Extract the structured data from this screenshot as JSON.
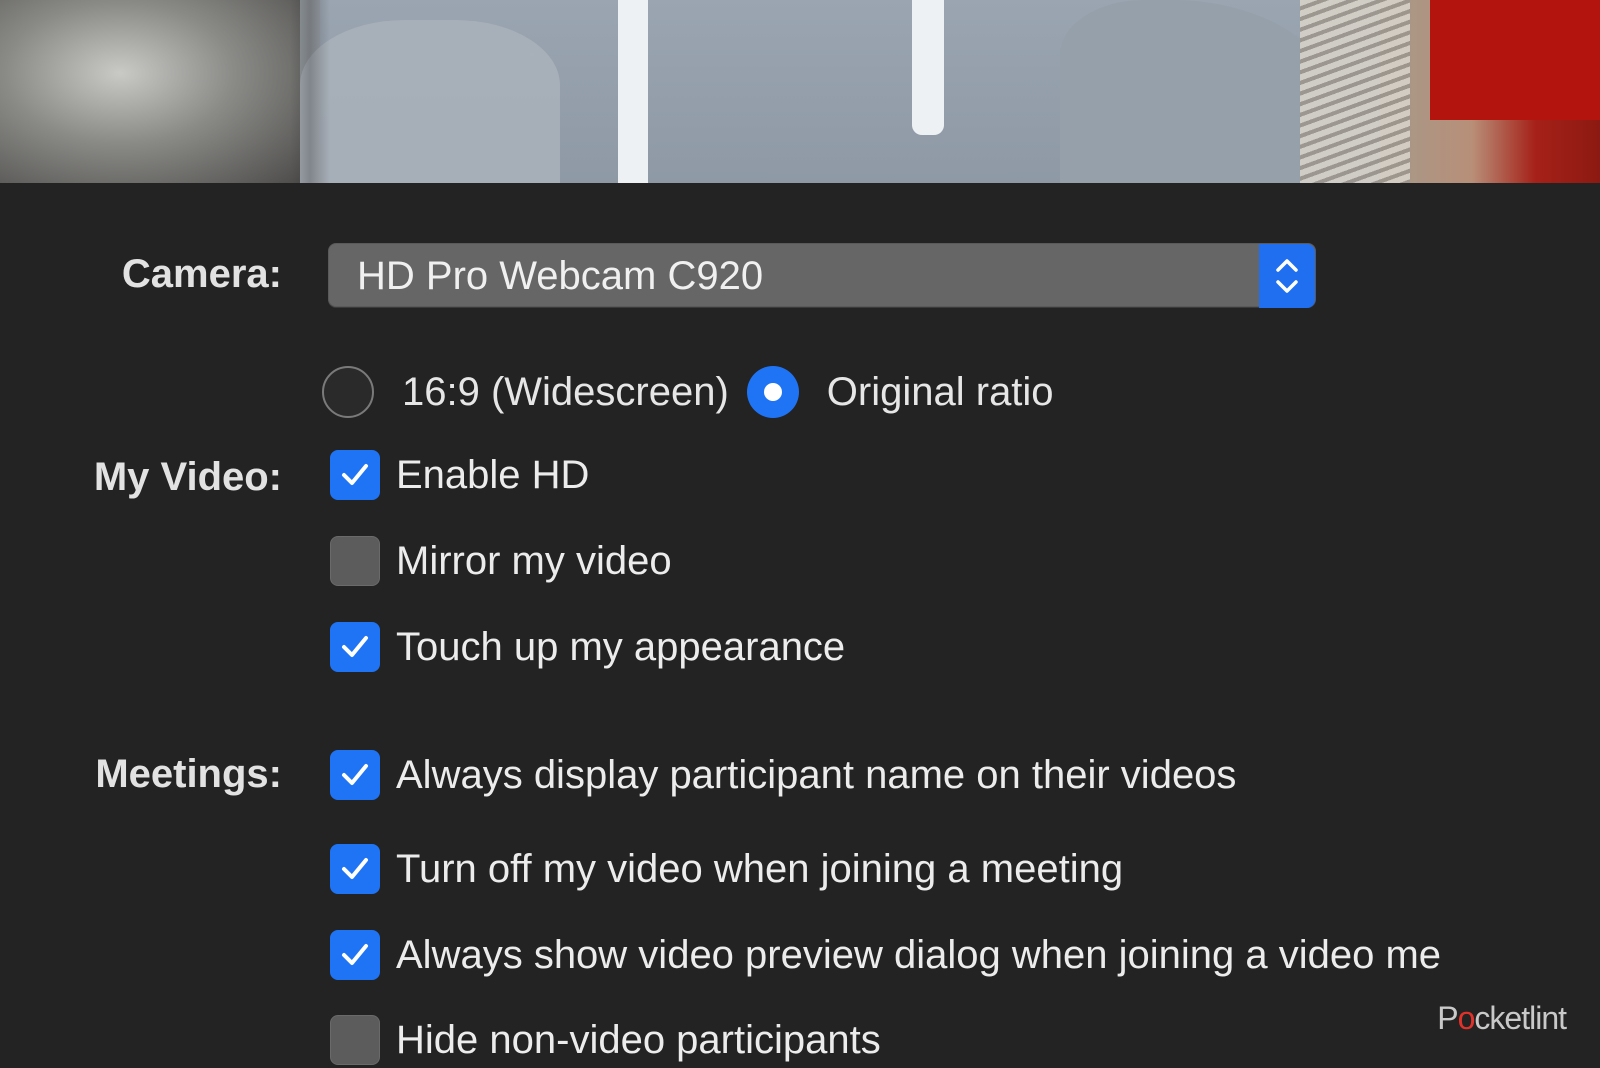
{
  "camera": {
    "label": "Camera:",
    "selected": "HD Pro Webcam C920"
  },
  "ratio": {
    "options": [
      {
        "label": "16:9 (Widescreen)",
        "selected": false
      },
      {
        "label": "Original ratio",
        "selected": true
      }
    ]
  },
  "my_video": {
    "label": "My Video:",
    "options": [
      {
        "label": "Enable HD",
        "checked": true
      },
      {
        "label": "Mirror my video",
        "checked": false
      },
      {
        "label": "Touch up my appearance",
        "checked": true
      }
    ]
  },
  "meetings": {
    "label": "Meetings:",
    "options": [
      {
        "label": "Always display participant name on their videos",
        "checked": true
      },
      {
        "label": "Turn off my video when joining a meeting",
        "checked": true
      },
      {
        "label": "Always show video preview dialog when joining a video me",
        "checked": true
      },
      {
        "label": "Hide non-video participants",
        "checked": false
      }
    ]
  },
  "watermark": {
    "text_before": "P",
    "text_icon": "o",
    "text_after": "cketlint"
  },
  "colors": {
    "background": "#232323",
    "accent": "#1f74f5",
    "select_bg": "#666666"
  }
}
